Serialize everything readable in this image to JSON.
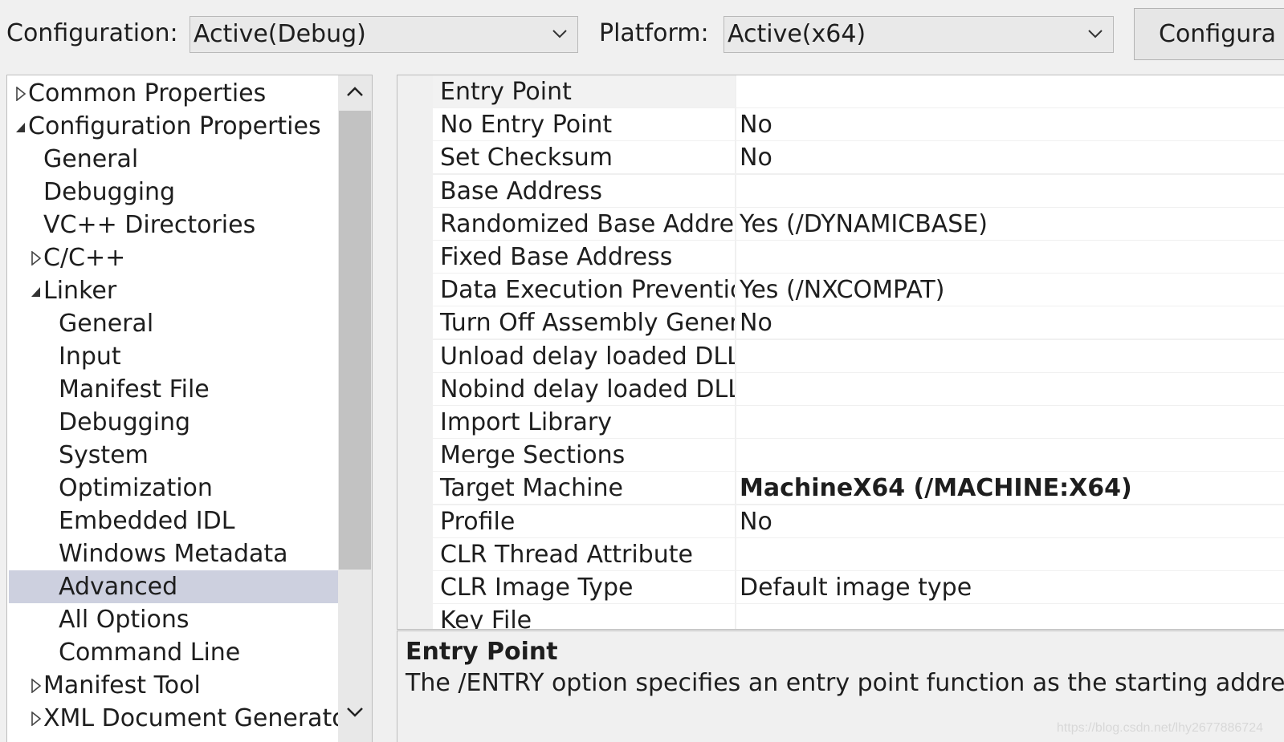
{
  "toolbar": {
    "configuration_label": "Configuration:",
    "configuration_value": "Active(Debug)",
    "platform_label": "Platform:",
    "platform_value": "Active(x64)",
    "configuration_manager_button": "Configura"
  },
  "tree": {
    "items": [
      {
        "label": "Common Properties",
        "toggle": "collapsed"
      },
      {
        "label": "Configuration Properties",
        "toggle": "expanded"
      },
      {
        "label": "General",
        "toggle": "none"
      },
      {
        "label": "Debugging",
        "toggle": "none"
      },
      {
        "label": "VC++ Directories",
        "toggle": "none"
      },
      {
        "label": "C/C++",
        "toggle": "collapsed"
      },
      {
        "label": "Linker",
        "toggle": "expanded"
      },
      {
        "label": "General",
        "toggle": "none"
      },
      {
        "label": "Input",
        "toggle": "none"
      },
      {
        "label": "Manifest File",
        "toggle": "none"
      },
      {
        "label": "Debugging",
        "toggle": "none"
      },
      {
        "label": "System",
        "toggle": "none"
      },
      {
        "label": "Optimization",
        "toggle": "none"
      },
      {
        "label": "Embedded IDL",
        "toggle": "none"
      },
      {
        "label": "Windows Metadata",
        "toggle": "none"
      },
      {
        "label": "Advanced",
        "toggle": "none",
        "selected": true
      },
      {
        "label": "All Options",
        "toggle": "none"
      },
      {
        "label": "Command Line",
        "toggle": "none"
      },
      {
        "label": "Manifest Tool",
        "toggle": "collapsed"
      },
      {
        "label": "XML Document Generator",
        "toggle": "collapsed"
      }
    ]
  },
  "properties": {
    "rows": [
      {
        "name": "Entry Point",
        "value": ""
      },
      {
        "name": "No Entry Point",
        "value": "No"
      },
      {
        "name": "Set Checksum",
        "value": "No"
      },
      {
        "name": "Base Address",
        "value": ""
      },
      {
        "name": "Randomized Base Address",
        "value": "Yes (/DYNAMICBASE)"
      },
      {
        "name": "Fixed Base Address",
        "value": ""
      },
      {
        "name": "Data Execution Prevention",
        "value": "Yes (/NXCOMPAT)"
      },
      {
        "name": "Turn Off Assembly Genera",
        "value": "No"
      },
      {
        "name": "Unload delay loaded DLL",
        "value": ""
      },
      {
        "name": "Nobind delay loaded DLL",
        "value": ""
      },
      {
        "name": "Import Library",
        "value": ""
      },
      {
        "name": "Merge Sections",
        "value": ""
      },
      {
        "name": "Target Machine",
        "value": "MachineX64 (/MACHINE:X64)",
        "bold": true
      },
      {
        "name": "Profile",
        "value": "No"
      },
      {
        "name": "CLR Thread Attribute",
        "value": ""
      },
      {
        "name": "CLR Image Type",
        "value": "Default image type"
      },
      {
        "name": "Key File",
        "value": ""
      }
    ]
  },
  "description": {
    "title": "Entry Point",
    "text": "The /ENTRY option specifies an entry point function as the starting address f"
  },
  "watermark": "https://blog.csdn.net/lhy2677886724",
  "colors": {
    "selection": "#cdd0df",
    "background": "#f0f0f0"
  }
}
